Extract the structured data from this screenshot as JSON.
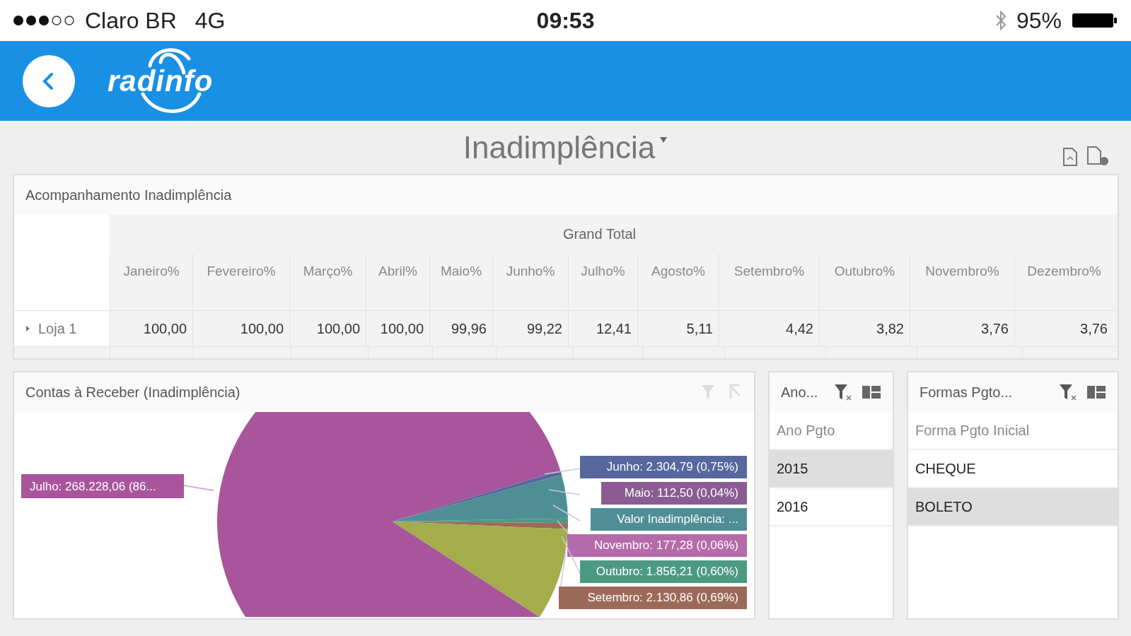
{
  "status_bar": {
    "carrier": "Claro BR",
    "network": "4G",
    "time": "09:53",
    "battery": "95%"
  },
  "header": {
    "logo": "radinfo"
  },
  "page_title": "Inadimplência",
  "pivot": {
    "title": "Acompanhamento Inadimplência",
    "grand_total": "Grand Total",
    "columns": [
      "Janeiro%",
      "Fevereiro%",
      "Março%",
      "Abril%",
      "Maio%",
      "Junho%",
      "Julho%",
      "Agosto%",
      "Setembro%",
      "Outubro%",
      "Novembro%",
      "Dezembro%"
    ],
    "rows": [
      {
        "label": "Loja 1",
        "expanded": false,
        "values": [
          "100,00",
          "100,00",
          "100,00",
          "100,00",
          "99,96",
          "99,22",
          "12,41",
          "5,11",
          "4,42",
          "3,82",
          "3,76",
          "3,76"
        ]
      }
    ]
  },
  "pie_panel": {
    "title": "Contas à Receber (Inadimplência)",
    "labels": [
      {
        "text": "Julho: 268.228,06 (86...",
        "color": "#a9559b"
      },
      {
        "text": "Junho: 2.304,79 (0,75%)",
        "color": "#56689e"
      },
      {
        "text": "Maio: 112,50 (0,04%)",
        "color": "#8a5c92"
      },
      {
        "text": "Valor Inadimplência: ...",
        "color": "#4f8e94"
      },
      {
        "text": "Novembro: 177,28 (0,06%)",
        "color": "#b56aa9"
      },
      {
        "text": "Outubro: 1.856,21 (0,60%)",
        "color": "#4d9a83"
      },
      {
        "text": "Setembro: 2.130,86 (0,69%)",
        "color": "#9c6a58"
      }
    ]
  },
  "filters": [
    {
      "title": "Ano...",
      "header": "Ano Pgto",
      "items": [
        {
          "label": "2015",
          "selected": true
        },
        {
          "label": "2016",
          "selected": false
        }
      ]
    },
    {
      "title": "Formas Pgto...",
      "header": "Forma Pgto Inicial",
      "items": [
        {
          "label": "CHEQUE",
          "selected": false
        },
        {
          "label": "BOLETO",
          "selected": true
        }
      ]
    }
  ]
}
